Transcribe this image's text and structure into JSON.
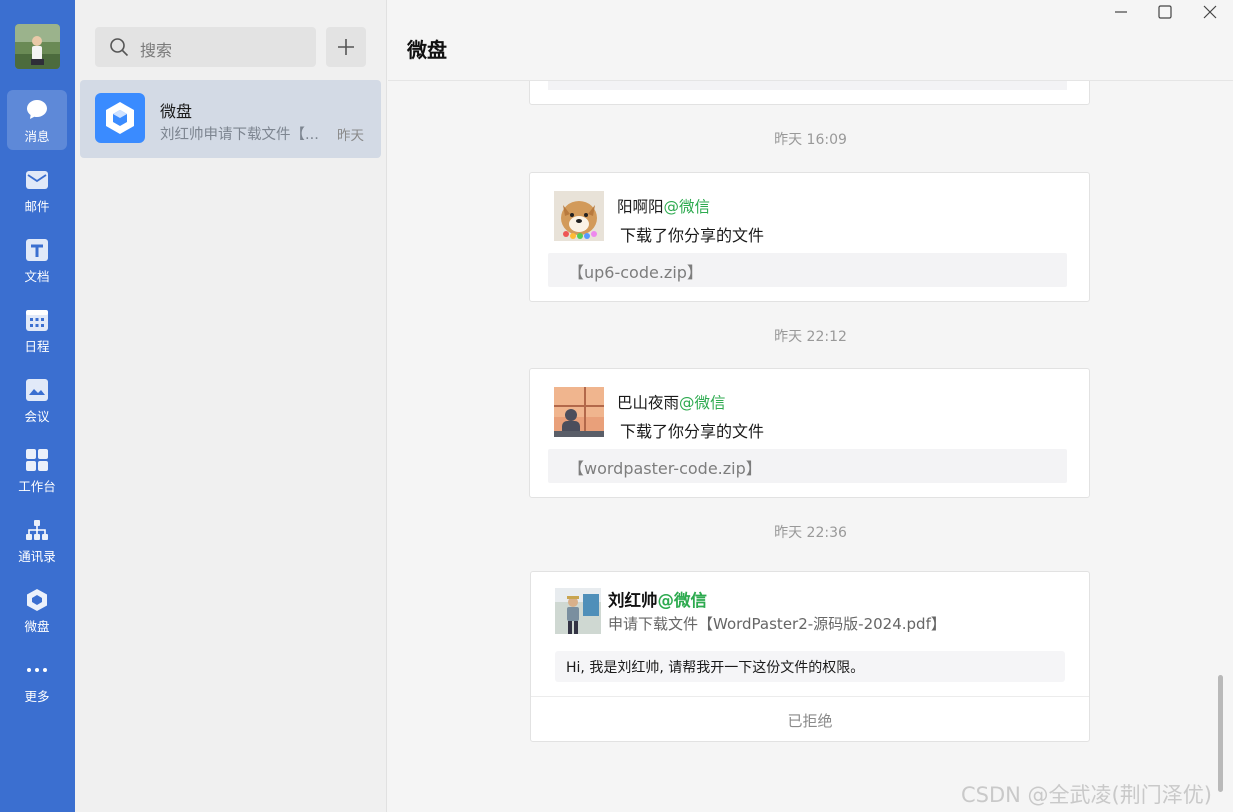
{
  "nav": {
    "items": [
      {
        "label": "消息",
        "icon": "chat-bubble-icon"
      },
      {
        "label": "邮件",
        "icon": "mail-icon"
      },
      {
        "label": "文档",
        "icon": "document-icon"
      },
      {
        "label": "日程",
        "icon": "calendar-icon"
      },
      {
        "label": "会议",
        "icon": "meeting-icon"
      },
      {
        "label": "工作台",
        "icon": "workbench-grid-icon"
      },
      {
        "label": "通讯录",
        "icon": "contacts-tree-icon"
      },
      {
        "label": "微盘",
        "icon": "weipan-cube-icon"
      },
      {
        "label": "更多",
        "icon": "more-dots-icon"
      }
    ],
    "accent": "#3b6fd0"
  },
  "search": {
    "placeholder": "搜索"
  },
  "conversation": {
    "name": "微盘",
    "preview": "刘红帅申请下载文件【...",
    "time": "昨天"
  },
  "header": {
    "title": "微盘"
  },
  "messages": [
    {
      "timestamp": "昨天 16:09",
      "user": "阳啊阳",
      "source": "@微信",
      "action": "下载了你分享的文件",
      "file": "【up6-code.zip】"
    },
    {
      "timestamp": "昨天 22:12",
      "user": "巴山夜雨",
      "source": "@微信",
      "action": "下载了你分享的文件",
      "file": "【wordpaster-code.zip】"
    }
  ],
  "request": {
    "timestamp": "昨天 22:36",
    "user": "刘红帅",
    "source": "@微信",
    "request_text": "申请下载文件【WordPaster2-源码版-2024.pdf】",
    "message": "Hi, 我是刘红帅, 请帮我开一下这份文件的权限。",
    "status": "已拒绝"
  },
  "watermark": "CSDN @全武凌(荆门泽优)",
  "colors": {
    "source_tag": "#2daa4f",
    "selected_conv": "#d3dae5",
    "weipan_icon": "#3a8bff"
  }
}
